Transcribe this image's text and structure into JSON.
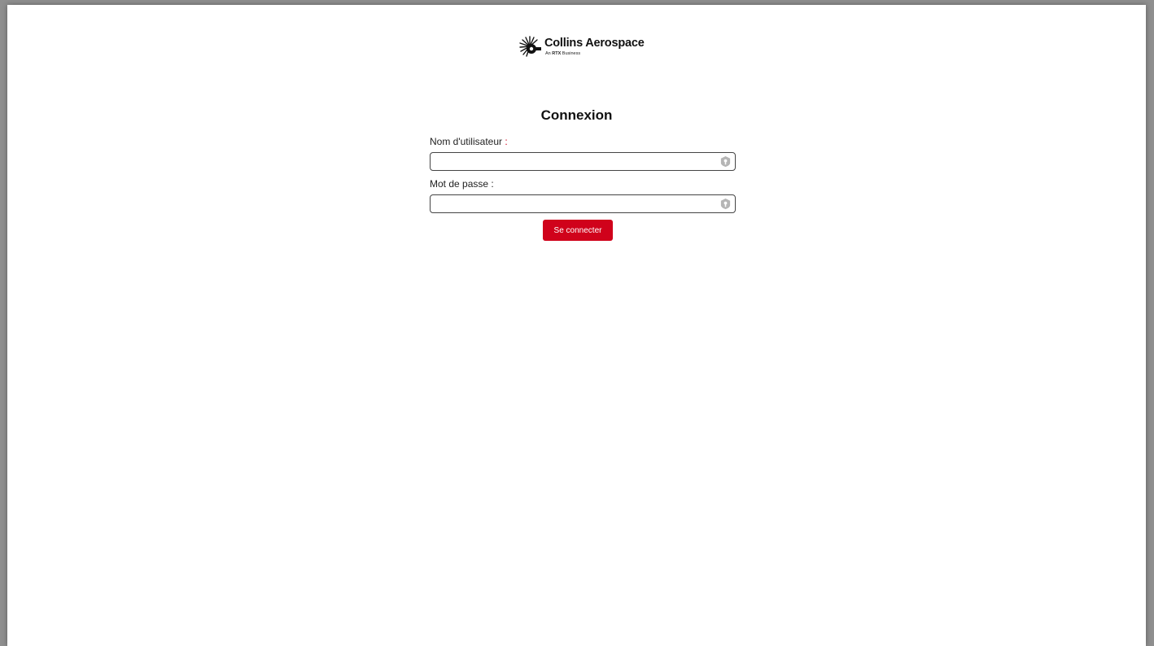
{
  "brand": {
    "name": "Collins Aerospace",
    "tagline_prefix": "An",
    "tagline_brand": "RTX",
    "tagline_suffix": "Business"
  },
  "login": {
    "title": "Connexion",
    "username_label": "Nom d'utilisateur",
    "username_colon": ":",
    "username_value": "",
    "password_label": "Mot de passe :",
    "password_value": "",
    "submit_label": "Se connecter"
  },
  "colors": {
    "accent": "#d0021b",
    "label_colon": "#d0021b",
    "field_icon": "#b5b5b5"
  },
  "icons": {
    "field_icon": "password-manager-icon"
  }
}
